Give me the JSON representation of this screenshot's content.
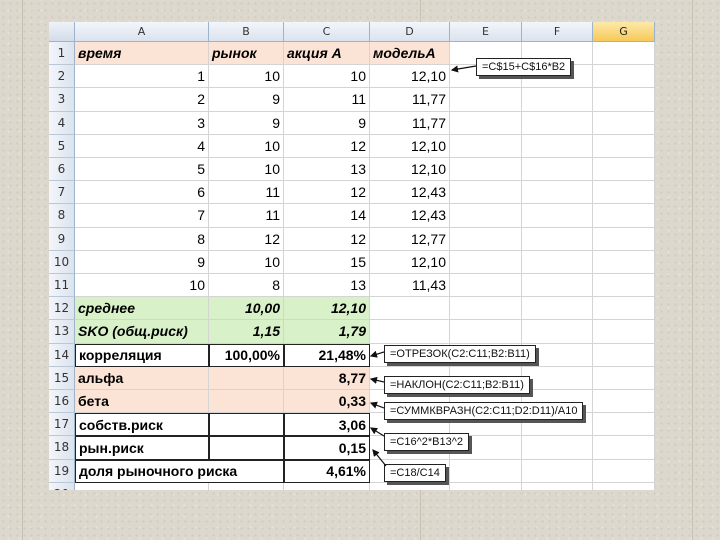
{
  "columns": [
    "A",
    "B",
    "C",
    "D",
    "E",
    "F",
    "G"
  ],
  "selected_column": "G",
  "row_numbers": [
    "1",
    "2",
    "3",
    "4",
    "5",
    "6",
    "7",
    "8",
    "9",
    "10",
    "11",
    "12",
    "13",
    "14",
    "15",
    "16",
    "17",
    "18",
    "19",
    "20"
  ],
  "header": {
    "a": "время",
    "b": "рынок",
    "c": "акция А",
    "d": "модельА"
  },
  "data_rows": [
    {
      "a": "1",
      "b": "10",
      "c": "10",
      "d": "12,10"
    },
    {
      "a": "2",
      "b": "9",
      "c": "11",
      "d": "11,77"
    },
    {
      "a": "3",
      "b": "9",
      "c": "9",
      "d": "11,77"
    },
    {
      "a": "4",
      "b": "10",
      "c": "12",
      "d": "12,10"
    },
    {
      "a": "5",
      "b": "10",
      "c": "13",
      "d": "12,10"
    },
    {
      "a": "6",
      "b": "11",
      "c": "12",
      "d": "12,43"
    },
    {
      "a": "7",
      "b": "11",
      "c": "14",
      "d": "12,43"
    },
    {
      "a": "8",
      "b": "12",
      "c": "12",
      "d": "12,77"
    },
    {
      "a": "9",
      "b": "10",
      "c": "15",
      "d": "12,10"
    },
    {
      "a": "10",
      "b": "8",
      "c": "13",
      "d": "11,43"
    }
  ],
  "stats": {
    "mean": {
      "label": "среднее",
      "b": "10,00",
      "c": "12,10"
    },
    "sko": {
      "label": "SKO (общ.риск)",
      "b": "1,15",
      "c": "1,79"
    },
    "corr": {
      "label": "корреляция",
      "b": "100,00%",
      "c": "21,48%"
    },
    "alpha": {
      "label": "альфа",
      "c": "8,77"
    },
    "beta": {
      "label": "бета",
      "c": "0,33"
    },
    "own_risk": {
      "label": "собств.риск",
      "c": "3,06"
    },
    "market_risk": {
      "label": "рын.риск",
      "c": "0,15"
    },
    "market_share": {
      "label": "доля рыночного риска",
      "c": "4,61%"
    }
  },
  "callouts": {
    "model": "=C$15+C$16*B2",
    "alpha": "=ОТРЕЗОК(C2:C11;B2:B11)",
    "beta": "=НАКЛОН(C2:C11;B2:B11)",
    "own_risk": "=СУММКВРАЗН(C2:C11;D2:D11)/A10",
    "market_risk": "=C16^2*B13^2",
    "market_share": "=C18/C14"
  }
}
